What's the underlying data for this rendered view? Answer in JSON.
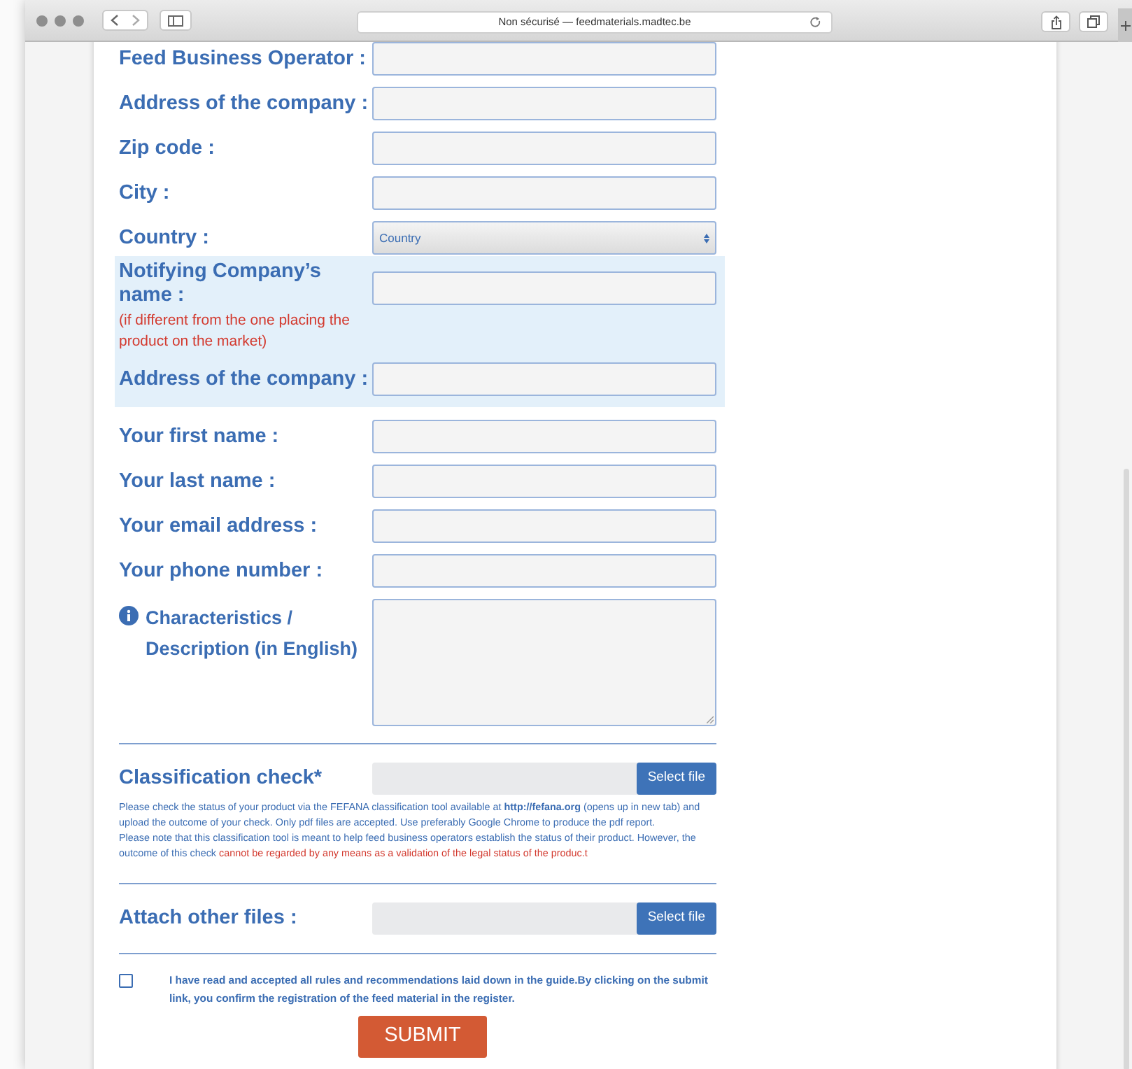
{
  "browser": {
    "address": "Non sécurisé — feedmaterials.madtec.be"
  },
  "company_fields": [
    {
      "label": "Feed Business Operator :",
      "kind": "text"
    },
    {
      "label": "Address of the company :",
      "kind": "text"
    },
    {
      "label": "Zip code :",
      "kind": "text"
    },
    {
      "label": "City :",
      "kind": "text"
    },
    {
      "label": "Country :",
      "kind": "select",
      "value": "Country"
    }
  ],
  "notifying_block": {
    "fields": [
      {
        "label": "Notifying Company’s name :",
        "note": "(if different from the one placing the product on the market)",
        "kind": "text"
      },
      {
        "label": "Address of the company :",
        "kind": "text"
      }
    ]
  },
  "contact_fields": [
    {
      "label": "Your first name :",
      "kind": "text"
    },
    {
      "label": "Your last name :",
      "kind": "text"
    },
    {
      "label": "Your email address :",
      "kind": "text"
    },
    {
      "label": "Your phone number :",
      "kind": "text"
    },
    {
      "label": "Characteristics / Description (in English)",
      "kind": "textarea"
    }
  ],
  "classification": {
    "label": "Classification check*",
    "button": "Select file",
    "help": [
      [
        {
          "text": "Please check the status of your product via the FEFANA classification tool available at **http://fefana.org** (opens up in new tab) and upload the outcome of your check. Only pdf files are accepted. Use preferably Google Chrome to produce the pdf report.",
          "kind": "normal"
        }
      ],
      [
        {
          "text": "Please note that this classification tool is meant to help feed business operators establish the status of their product. However, the outcome of this check ",
          "kind": "normal"
        },
        {
          "text": "cannot be regarded by any means as a validation of the legal status of the produc.t",
          "kind": "warning"
        }
      ]
    ]
  },
  "attach": {
    "label": "Attach other files :",
    "button": "Select file"
  },
  "agreement": {
    "checked": false,
    "text": "I have read and accepted all rules and recommendations laid down in the guide.By clicking on the submit link, you confirm the registration of the feed material in the register."
  },
  "submit": "SUBMIT"
}
